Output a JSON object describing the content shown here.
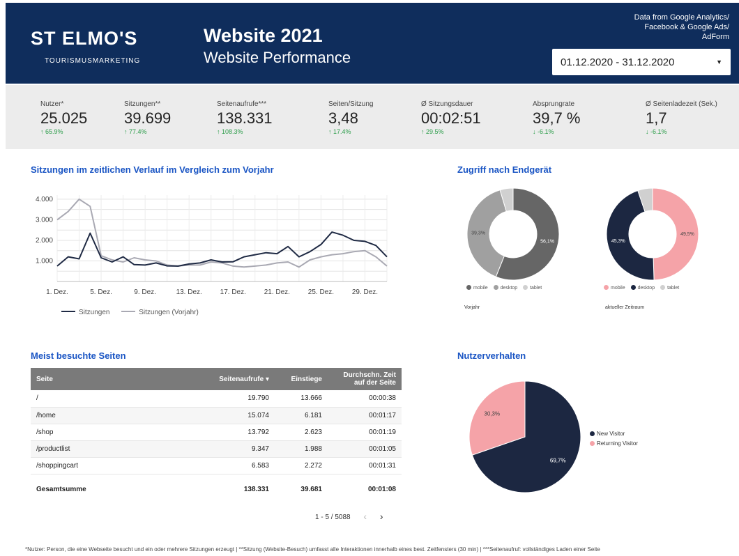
{
  "header": {
    "logo": "ST ELMO'S",
    "logo_sub": "TOURISMUSMARKETING",
    "title": "Website 2021",
    "subtitle": "Website Performance",
    "source_line1": "Data from Google Analytics/",
    "source_line2": "Facebook & Google Ads/",
    "source_line3": "AdForm",
    "date_range": "01.12.2020 - 31.12.2020"
  },
  "kpis": [
    {
      "label": "Nutzer*",
      "value": "25.025",
      "change": "↑ 65.9%",
      "dir": "up"
    },
    {
      "label": "Sitzungen**",
      "value": "39.699",
      "change": "↑ 77.4%",
      "dir": "up"
    },
    {
      "label": "Seitenaufrufe***",
      "value": "138.331",
      "change": "↑ 108.3%",
      "dir": "up"
    },
    {
      "label": "Seiten/Sitzung",
      "value": "3,48",
      "change": "↑ 17.4%",
      "dir": "up"
    },
    {
      "label": "Ø Sitzungsdauer",
      "value": "00:02:51",
      "change": "↑ 29.5%",
      "dir": "up"
    },
    {
      "label": "Absprungrate",
      "value": "39,7 %",
      "change": "↓ -6.1%",
      "dir": "down"
    },
    {
      "label": "Ø Seitenladezeit (Sek.)",
      "value": "1,7",
      "change": "↓ -6.1%",
      "dir": "down"
    }
  ],
  "sections": {
    "line_title": "Sitzungen im zeitlichen Verlauf im Vergleich zum Vorjahr",
    "device_title": "Zugriff nach Endgerät",
    "pages_title": "Meist besuchte Seiten",
    "behavior_title": "Nutzerverhalten"
  },
  "chart_data": [
    {
      "type": "line",
      "x": [
        "1. Dez.",
        "2. Dez.",
        "3. Dez.",
        "4. Dez.",
        "5. Dez.",
        "6. Dez.",
        "7. Dez.",
        "8. Dez.",
        "9. Dez.",
        "10. Dez.",
        "11. Dez.",
        "12. Dez.",
        "13. Dez.",
        "14. Dez.",
        "15. Dez.",
        "16. Dez.",
        "17. Dez.",
        "18. Dez.",
        "19. Dez.",
        "20. Dez.",
        "21. Dez.",
        "22. Dez.",
        "23. Dez.",
        "24. Dez.",
        "25. Dez.",
        "26. Dez.",
        "27. Dez.",
        "28. Dez.",
        "29. Dez.",
        "30. Dez.",
        "31. Dez."
      ],
      "x_tick_labels": [
        "1. Dez.",
        "5. Dez.",
        "9. Dez.",
        "13. Dez.",
        "17. Dez.",
        "21. Dez.",
        "25. Dez.",
        "29. Dez."
      ],
      "y_tick_labels": [
        "1.000",
        "2.000",
        "3.000",
        "4.000"
      ],
      "ylim": [
        0,
        4200
      ],
      "series": [
        {
          "name": "Sitzungen",
          "color": "#1f2a44",
          "values": [
            750,
            1200,
            1100,
            2350,
            1150,
            950,
            1200,
            820,
            800,
            900,
            760,
            750,
            850,
            900,
            1050,
            950,
            960,
            1200,
            1300,
            1400,
            1350,
            1700,
            1200,
            1450,
            1800,
            2400,
            2250,
            2000,
            1950,
            1750,
            1200
          ]
        },
        {
          "name": "Sitzungen (Vorjahr)",
          "color": "#a9a9b3",
          "values": [
            3000,
            3400,
            4000,
            3650,
            1250,
            1050,
            950,
            1150,
            1050,
            1000,
            800,
            750,
            800,
            800,
            950,
            900,
            750,
            700,
            750,
            800,
            900,
            950,
            700,
            1050,
            1200,
            1300,
            1350,
            1450,
            1500,
            1200,
            750
          ]
        }
      ],
      "grid": true,
      "legend": "bottom-left"
    },
    {
      "type": "pie",
      "title": "Vorjahr",
      "labels": [
        "mobile",
        "desktop",
        "tablet"
      ],
      "values": [
        56.1,
        39.3,
        4.6
      ],
      "colors": [
        "#666666",
        "#a0a0a0",
        "#d0d0d0"
      ],
      "value_labels": [
        "56,1%",
        "39,3%",
        ""
      ]
    },
    {
      "type": "pie",
      "title": "aktueller Zeitraum",
      "labels": [
        "mobile",
        "desktop",
        "tablet"
      ],
      "values": [
        49.5,
        45.3,
        5.2
      ],
      "colors": [
        "#f5a3a8",
        "#1c2741",
        "#d0d0d0"
      ],
      "value_labels": [
        "49,5%",
        "45,3%",
        ""
      ]
    },
    {
      "type": "pie",
      "labels": [
        "New Visitor",
        "Returning Visitor"
      ],
      "values": [
        69.7,
        30.3
      ],
      "colors": [
        "#1c2741",
        "#f5a3a8"
      ],
      "value_labels": [
        "69,7%",
        "30,3%"
      ],
      "legend": "right"
    }
  ],
  "table": {
    "headers": [
      "Seite",
      "Seitenaufrufe ▾",
      "Einstiege",
      "Durchschn. Zeit auf der Seite"
    ],
    "rows": [
      [
        "/",
        "19.790",
        "13.666",
        "00:00:38"
      ],
      [
        "/home",
        "15.074",
        "6.181",
        "00:01:17"
      ],
      [
        "/shop",
        "13.792",
        "2.623",
        "00:01:19"
      ],
      [
        "/productlist",
        "9.347",
        "1.988",
        "00:01:05"
      ],
      [
        "/shoppingcart",
        "6.583",
        "2.272",
        "00:01:31"
      ]
    ],
    "total": [
      "Gesamtsumme",
      "138.331",
      "39.681",
      "00:01:08"
    ],
    "pager": "1 - 5 / 5088"
  },
  "footnote": "*Nutzer: Person, die eine Webseite besucht und ein oder mehrere Sitzungen erzeugt | **Sitzung (Website-Besuch) umfasst alle Interaktionen innerhalb eines best. Zeitfensters (30 min) | ***Seitenaufruf: vollständiges Laden einer Seite"
}
